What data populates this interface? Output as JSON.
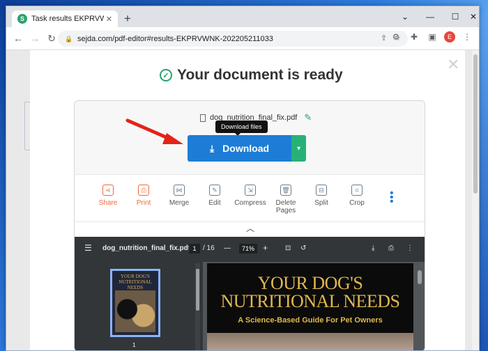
{
  "browser": {
    "tab_title": "Task results EKPRVWNK-20220521...",
    "favicon_letter": "S",
    "url": "sejda.com/pdf-editor#results-EKPRVWNK-202205211033",
    "avatar_letter": "E"
  },
  "result": {
    "title": "Your document is ready",
    "filename": "dog_nutrition_final_fix.pdf",
    "tooltip": "Download files",
    "download_label": "Download"
  },
  "actions": [
    {
      "label": "Share",
      "icon": "share-icon"
    },
    {
      "label": "Print",
      "icon": "print-icon"
    },
    {
      "label": "Merge",
      "icon": "merge-icon"
    },
    {
      "label": "Edit",
      "icon": "edit-icon"
    },
    {
      "label": "Compress",
      "icon": "compress-icon"
    },
    {
      "label": "Delete Pages",
      "icon": "delete-icon"
    },
    {
      "label": "Split",
      "icon": "split-icon"
    },
    {
      "label": "Crop",
      "icon": "crop-icon"
    }
  ],
  "viewer": {
    "filename": "dog_nutrition_final_fix.pdf",
    "current_page": "1",
    "total_pages": "/ 16",
    "zoom": "71%",
    "thumb_number": "1",
    "cover_title_line1": "YOUR DOG'S",
    "cover_title_line2": "NUTRITIONAL NEEDS",
    "cover_subtitle": "A Science-Based Guide For Pet Owners",
    "thumb_title": "YOUR DOG'S NUTRITIONAL NEEDS"
  }
}
